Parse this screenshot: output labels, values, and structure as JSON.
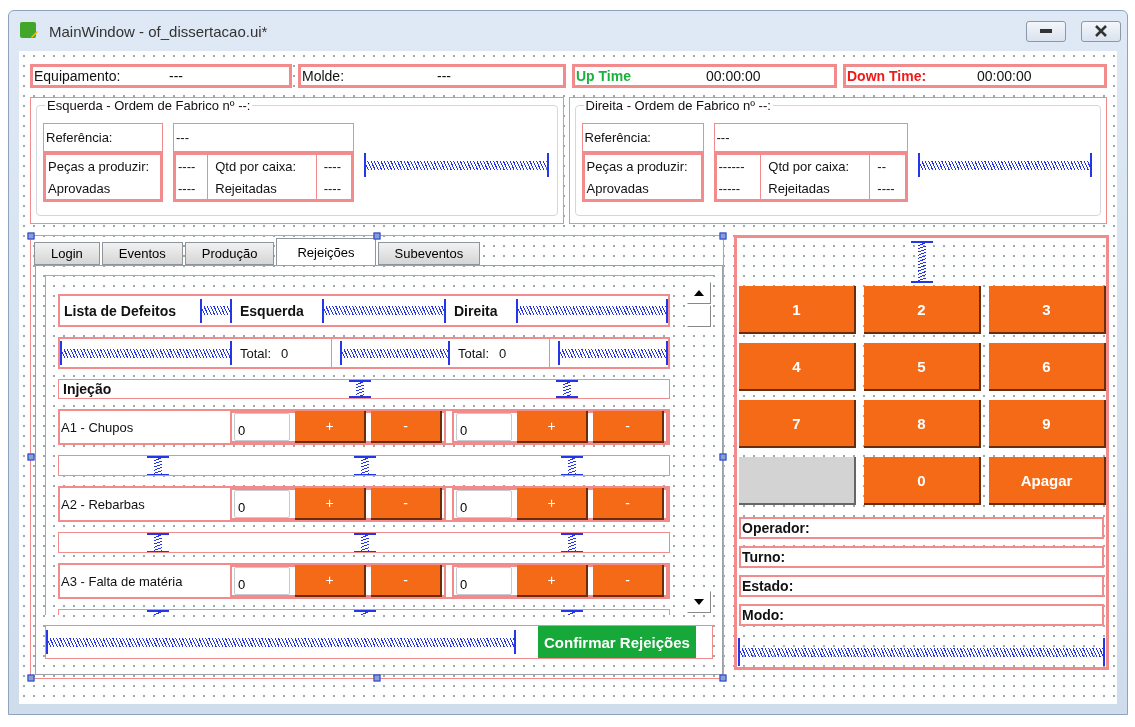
{
  "window": {
    "title": "MainWindow - of_dissertacao.ui*"
  },
  "status_fields": [
    {
      "label": "Equipamento:",
      "value": "---",
      "kind": "normal"
    },
    {
      "label": "Molde:",
      "value": "---",
      "kind": "normal"
    },
    {
      "label": "Up Time",
      "value": "00:00:00",
      "kind": "up"
    },
    {
      "label": "Down Time:",
      "value": "00:00:00",
      "kind": "down"
    }
  ],
  "orders": [
    {
      "title": "Esquerda - Ordem de Fabrico nº --:",
      "reference_label": "Referência:",
      "reference_value": "---",
      "pieces_label": "Peças a produzir:",
      "pieces_value": "----",
      "approved_label": "Aprovadas",
      "approved_value": "----",
      "per_box_label": "Qtd por caixa:",
      "per_box_value": "----",
      "rejected_label": "Rejeitadas",
      "rejected_value": "----"
    },
    {
      "title": "Direita - Ordem de Fabrico nº --:",
      "reference_label": "Referência:",
      "reference_value": "---",
      "pieces_label": "Peças a produzir:",
      "pieces_value": "------",
      "approved_label": "Aprovadas",
      "approved_value": "-----",
      "per_box_label": "Qtd por caixa:",
      "per_box_value": "--",
      "rejected_label": "Rejeitadas",
      "rejected_value": "----"
    }
  ],
  "tabs": [
    {
      "label": "Login",
      "selected": false
    },
    {
      "label": "Eventos",
      "selected": false
    },
    {
      "label": "Produção",
      "selected": false
    },
    {
      "label": "Rejeições",
      "selected": true
    },
    {
      "label": "Subeventos",
      "selected": false
    }
  ],
  "rejections": {
    "headers": [
      "Lista de Defeitos",
      "Esquerda",
      "Direita"
    ],
    "totals": [
      {
        "label": "Total:",
        "value": "0"
      },
      {
        "label": "Total:",
        "value": "0"
      }
    ],
    "section": "Injeção",
    "defects": [
      {
        "name": "A1 - Chupos",
        "sides": [
          {
            "value": "0",
            "plus": "+",
            "minus": "-"
          },
          {
            "value": "0",
            "plus": "+",
            "minus": "-"
          }
        ]
      },
      {
        "name": "A2 - Rebarbas",
        "sides": [
          {
            "value": "0",
            "plus": "+",
            "minus": "-"
          },
          {
            "value": "0",
            "plus": "+",
            "minus": "-"
          }
        ]
      },
      {
        "name": "A3 - Falta de matéria",
        "sides": [
          {
            "value": "0",
            "plus": "+",
            "minus": "-"
          },
          {
            "value": "0",
            "plus": "+",
            "minus": "-"
          }
        ]
      }
    ],
    "confirm": "Confirmar Rejeições"
  },
  "keypad": [
    {
      "kind": "key",
      "label": "1"
    },
    {
      "kind": "key",
      "label": "2"
    },
    {
      "kind": "key",
      "label": "3"
    },
    {
      "kind": "key",
      "label": "4"
    },
    {
      "kind": "key",
      "label": "5"
    },
    {
      "kind": "key",
      "label": "6"
    },
    {
      "kind": "key",
      "label": "7"
    },
    {
      "kind": "key",
      "label": "8"
    },
    {
      "kind": "key",
      "label": "9"
    },
    {
      "kind": "blank"
    },
    {
      "kind": "key",
      "label": "0"
    },
    {
      "kind": "key",
      "label": "Apagar"
    }
  ],
  "info": [
    "Operador:",
    "Turno:",
    "Estado:",
    "Modo:"
  ]
}
